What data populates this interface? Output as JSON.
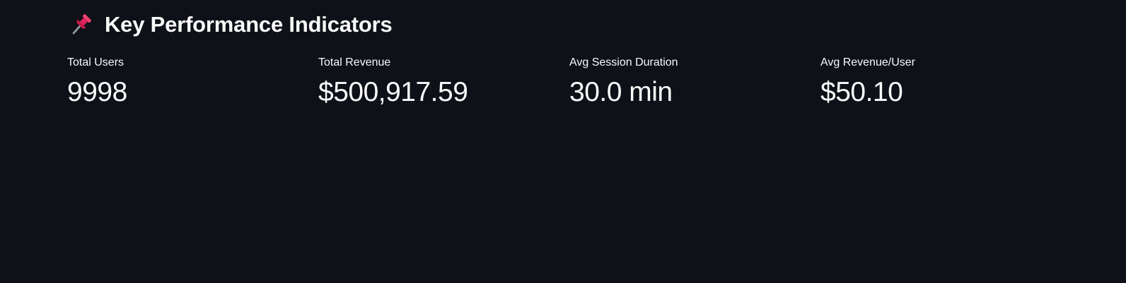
{
  "header": {
    "icon": "pushpin-icon",
    "title": "Key Performance Indicators"
  },
  "metrics": [
    {
      "label": "Total Users",
      "value": "9998"
    },
    {
      "label": "Total Revenue",
      "value": "$500,917.59"
    },
    {
      "label": "Avg Session Duration",
      "value": "30.0 min"
    },
    {
      "label": "Avg Revenue/User",
      "value": "$50.10"
    }
  ],
  "colors": {
    "background": "#0e1117",
    "text": "#fafafa",
    "pin": "#e0245e"
  }
}
